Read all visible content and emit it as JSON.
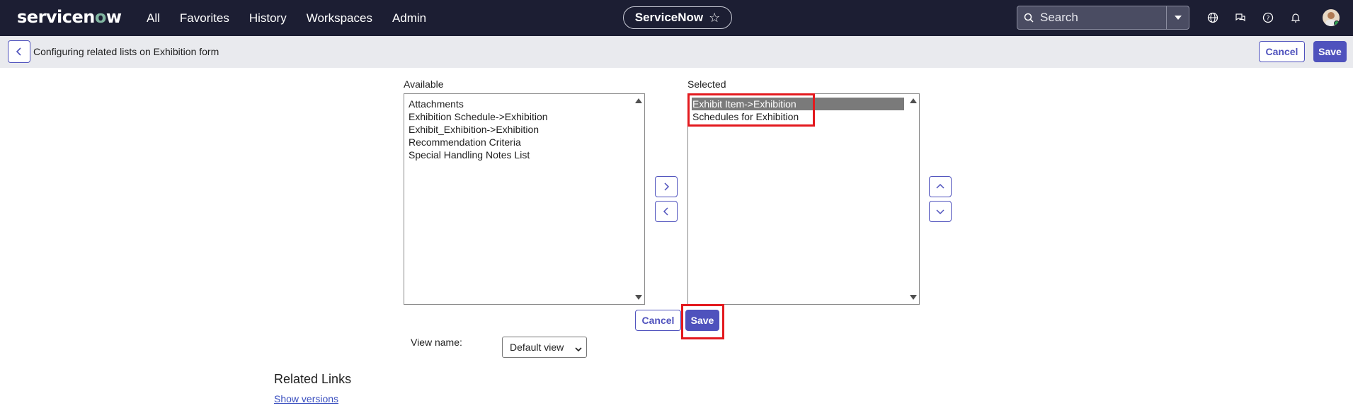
{
  "brand": {
    "name_part1": "servicen",
    "name_o": "o",
    "name_part2": "w"
  },
  "nav": {
    "items": [
      "All",
      "Favorites",
      "History",
      "Workspaces",
      "Admin"
    ],
    "center_pill": "ServiceNow",
    "search_placeholder": "Search",
    "icons": [
      "globe-icon",
      "chat-icon",
      "help-icon",
      "bell-icon",
      "avatar"
    ]
  },
  "subheader": {
    "title": "Configuring related lists on Exhibition form",
    "cancel_label": "Cancel",
    "save_label": "Save"
  },
  "slushbucket": {
    "available_label": "Available",
    "selected_label": "Selected",
    "available_items": [
      "Attachments",
      "Exhibition Schedule->Exhibition",
      "Exhibit_Exhibition->Exhibition",
      "Recommendation Criteria",
      "Special Handling Notes List"
    ],
    "selected_items": [
      {
        "label": "Exhibit Item->Exhibition",
        "selected": true
      },
      {
        "label": "Schedules for Exhibition",
        "selected": false
      }
    ],
    "cancel_label": "Cancel",
    "save_label": "Save"
  },
  "view": {
    "label": "View name:",
    "selected_value": "Default view"
  },
  "related_links": {
    "title": "Related Links",
    "show_versions": "Show versions"
  },
  "colors": {
    "nav_bg": "#1c1e33",
    "accent": "#4f52bd",
    "highlight": "#e3191e"
  }
}
